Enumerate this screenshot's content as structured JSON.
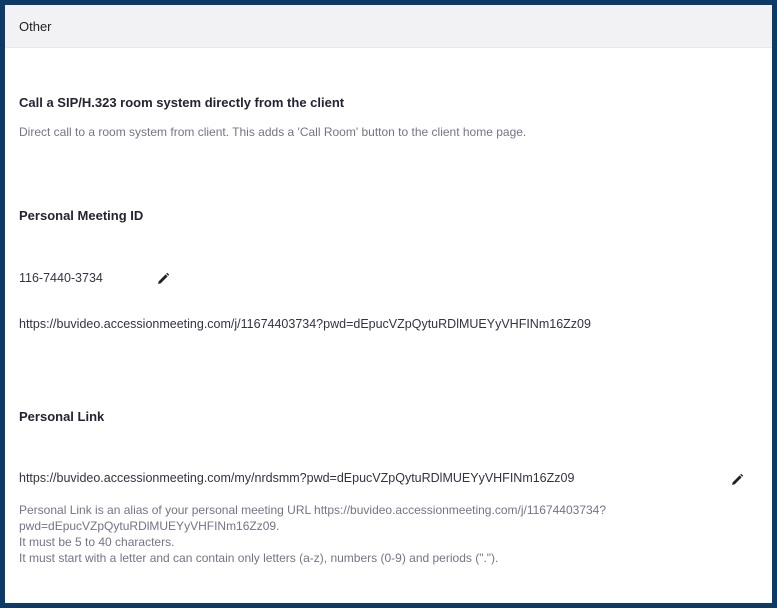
{
  "section": {
    "title": "Other"
  },
  "call_room": {
    "heading": "Call a SIP/H.323 room system directly from the client",
    "description": "Direct call to a room system from client. This adds a 'Call Room' button to the client home page."
  },
  "pmi": {
    "heading": "Personal Meeting ID",
    "id_value": "116-7440-3734",
    "edit_icon": "pencil-icon",
    "url": "https://buvideo.accessionmeeting.com/j/11674403734?pwd=dEpucVZpQytuRDlMUEYyVHFINm16Zz09"
  },
  "personal_link": {
    "heading": "Personal Link",
    "url": "https://buvideo.accessionmeeting.com/my/nrdsmm?pwd=dEpucVZpQytuRDlMUEYyVHFINm16Zz09",
    "edit_icon": "pencil-icon",
    "notes": [
      "Personal Link is an alias of your personal meeting URL https://buvideo.accessionmeeting.com/j/11674403734?",
      "pwd=dEpucVZpQytuRDlMUEYyVHFINm16Zz09.",
      "It must be 5 to 40 characters.",
      "It must start with a letter and can contain only letters (a-z), numbers (0-9) and periods (\".\")."
    ]
  },
  "colors": {
    "frame_border": "#0d3a66",
    "header_bg": "#f2f2f4",
    "heading_text": "#232333",
    "description_text": "#747487"
  }
}
